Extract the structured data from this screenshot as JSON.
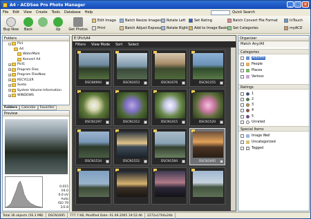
{
  "window": {
    "title": "A4 - ACDSee Pro Photo Manager"
  },
  "menu": [
    "File",
    "Edit",
    "View",
    "Create",
    "Tools",
    "Database",
    "Help"
  ],
  "quick_search": {
    "label": "Quick Search"
  },
  "toolbar": {
    "back_now": "Bup Now",
    "back": "Back",
    "up": "Up",
    "get_photos": "Get Photos",
    "edit_image": "Edit Image",
    "print": "Print",
    "batch_resize": "Batch Resize Images",
    "batch_adjust": "Batch Adjust Exposure",
    "rotate_left": "Rotate Left",
    "rotate_right": "Rotate Right",
    "set_rating": "Set Rating",
    "add_basket": "Add to Image Basket",
    "batch_convert": "Batch Convert File Format",
    "set_categories": "Set Categories",
    "intouch": "InTouch",
    "myacd": "myACD"
  },
  "folders": {
    "title": "Folders",
    "items": [
      "Pict",
      "A4",
      "WaterMark",
      "Konvert A4",
      "Pict1",
      "Program Files",
      "Program FilesNew",
      "RECYCLER",
      "Sveta",
      "System Volume Information",
      "WINDOWS"
    ],
    "tabs": [
      "Folders",
      "Calendar",
      "Favorites"
    ]
  },
  "preview": {
    "title": "Preview",
    "exif": [
      "0.015",
      "f/4.0",
      "0.0 eV",
      "Auto",
      "ISO 79",
      "1/2.8"
    ]
  },
  "main": {
    "path": "E:\\Pict\\A4",
    "filters": "Filters",
    "view_mode": "View Mode",
    "sort": "Sort",
    "select": "Select",
    "thumbs": [
      "DSCN0994",
      "DSCN1053",
      "DSCN1076",
      "DSCN1255",
      "DSCN1297",
      "DSCN1312",
      "DSCN1415",
      "DSCN1520",
      "DSCN1534",
      "DSCN1552",
      "DSCN1584",
      "DSCN1695",
      "",
      "",
      "",
      ""
    ]
  },
  "organizer": {
    "title": "Organizer",
    "match": "Match Any/All",
    "categories_title": "Categories",
    "categories": [
      "Albums",
      "People",
      "Places",
      "Various"
    ],
    "ratings_title": "Ratings",
    "ratings": [
      "1",
      "2",
      "3",
      "4",
      "5",
      "Unrated"
    ],
    "rating_colors": [
      "#1f4fbf",
      "#2e9a2e",
      "#d9a21b",
      "#c9371e",
      "#8a2db2",
      "#ffffff"
    ],
    "special_title": "Special Items",
    "special": [
      "Image Well",
      "Uncategorized",
      "Tagged"
    ]
  },
  "status": {
    "total": "Total 36 objects (56.3 MB)",
    "name": "DSCN1695",
    "info": "777.7 KB, Modified Date: 01.09.2005 19:52:46",
    "dims": "2272x1704x24b"
  }
}
